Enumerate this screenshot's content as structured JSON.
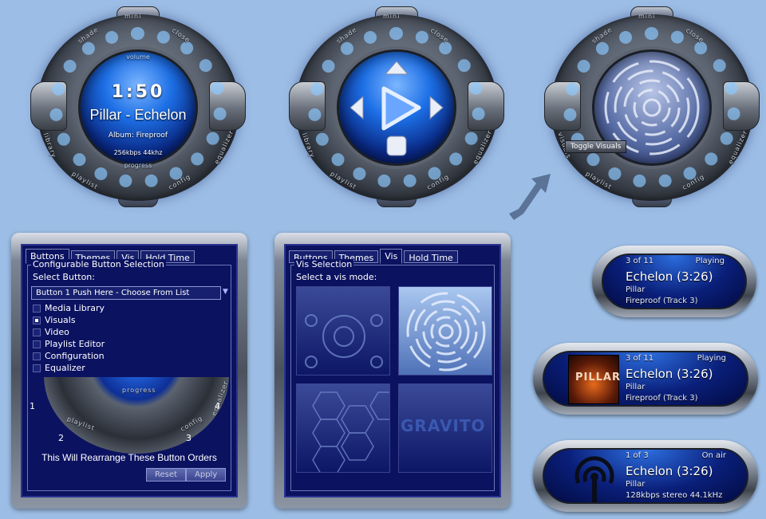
{
  "players": {
    "p1": {
      "ring_labels": {
        "top": "mini",
        "tl": "shade",
        "tr": "close",
        "left": "library",
        "right": "equalizer",
        "bl": "playlist",
        "br": "config",
        "volume": "volume",
        "progress": "progress"
      },
      "time": "1:50",
      "track": "Pillar - Echelon",
      "album": "Album: Fireproof",
      "info": "256kbps 44khz"
    },
    "p2": {
      "ring_labels": {
        "top": "mini",
        "tl": "shade",
        "tr": "close",
        "left": "library",
        "right": "equalizer",
        "bl": "playlist",
        "br": "config"
      }
    },
    "p3": {
      "ring_labels": {
        "top": "mini",
        "tl": "shade",
        "tr": "close",
        "left": "visuals",
        "right": "equalizer",
        "bl": "playlist",
        "br": "config"
      },
      "tooltip": "Toggle Visuals"
    }
  },
  "panel1": {
    "tabs": [
      "Buttons",
      "Themes",
      "Vis",
      "Hold Time"
    ],
    "group_title": "Configurable Button Selection",
    "select_label": "Select Button:",
    "select_value": "Button 1 Push Here - Choose From List",
    "options": [
      {
        "label": "Media Library",
        "checked": false
      },
      {
        "label": "Visuals",
        "checked": true
      },
      {
        "label": "Video",
        "checked": false
      },
      {
        "label": "Playlist Editor",
        "checked": false
      },
      {
        "label": "Configuration",
        "checked": false
      },
      {
        "label": "Equalizer",
        "checked": false
      }
    ],
    "ring_labels": {
      "progress": "progress",
      "playlist": "playlist",
      "config": "config",
      "equalizer": "equalizer"
    },
    "numbers": [
      "1",
      "2",
      "3",
      "4"
    ],
    "note": "This Will Rearrange These Button Orders",
    "reset": "Reset",
    "apply": "Apply"
  },
  "panel2": {
    "tabs": [
      "Buttons",
      "Themes",
      "Vis",
      "Hold Time"
    ],
    "group_title": "Vis Selection",
    "select_label": "Select a vis mode:",
    "vis_text": "GRAVITO"
  },
  "pills": [
    {
      "count": "3 of 11",
      "state": "Playing",
      "title": "Echelon (3:26)",
      "artist": "Pillar",
      "detail": "Fireproof (Track 3)"
    },
    {
      "count": "3 of 11",
      "state": "Playing",
      "title": "Echelon (3:26)",
      "artist": "Pillar",
      "detail": "Fireproof (Track 3)",
      "art": "PILLAR"
    },
    {
      "count": "1 of 3",
      "state": "On air",
      "title": "Echelon (3:26)",
      "artist": "Pillar",
      "detail": "128kbps stereo 44.1kHz"
    }
  ],
  "colors": {
    "background": "#9cbde5",
    "panel": "#0b1260",
    "accent": "#2d6fe0"
  }
}
